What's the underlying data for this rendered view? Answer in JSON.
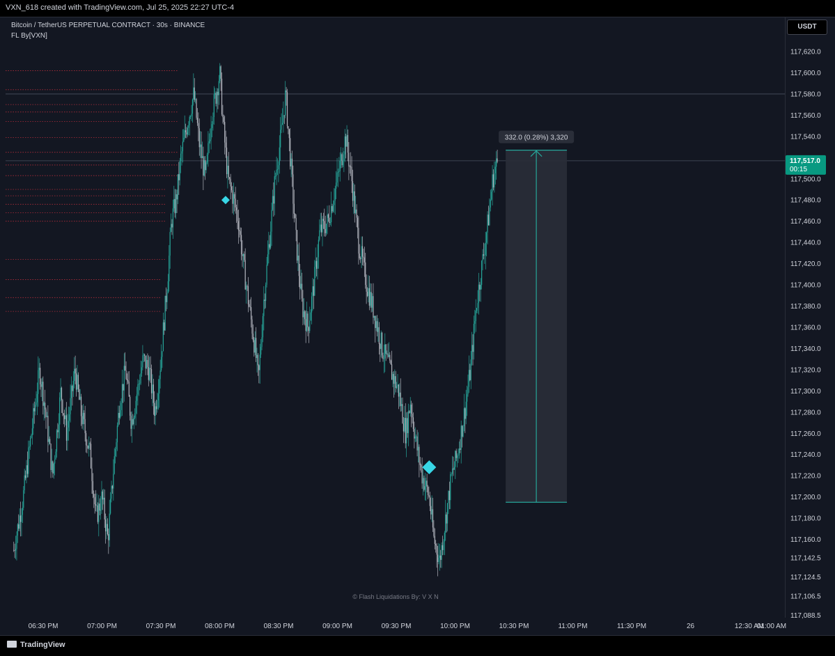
{
  "header": {
    "attribution": "VXN_618 created with TradingView.com, Jul 25, 2025 22:27 UTC-4"
  },
  "legend": {
    "symbol_line": "Bitcoin / TetherUS PERPETUAL CONTRACT · 30s · BINANCE",
    "indicator_line": "FL By[VXN]"
  },
  "currency_button": "USDT",
  "watermark": "© Flash Liquidations By: V X N",
  "footer": {
    "brand": "TradingView"
  },
  "colors": {
    "background": "#131722",
    "up": "#26a69a",
    "neutral": "#b2b5be",
    "marker": "#38d6e6",
    "price_tag": "#089981",
    "level": "#f23645"
  },
  "chart_data": {
    "type": "candlestick",
    "symbol": "BTCUSDT.P",
    "interval": "30s",
    "last_price": 117517.0,
    "last_price_label": "117,517.0",
    "countdown": "00:15",
    "ylim": [
      117080,
      117640
    ],
    "y_ticks": [
      117620,
      117600,
      117580,
      117560,
      117540,
      117520,
      117500,
      117480,
      117460,
      117440,
      117420,
      117400,
      117380,
      117360,
      117340,
      117320,
      117300,
      117280,
      117260,
      117240,
      117220,
      117200,
      117180,
      117160,
      117142.5,
      117124.5,
      117106.5,
      117088.5
    ],
    "y_tick_labels": [
      "117,620.0",
      "117,600.0",
      "117,580.0",
      "117,560.0",
      "117,540.0",
      "117,520.0",
      "117,500.0",
      "117,480.0",
      "117,460.0",
      "117,440.0",
      "117,420.0",
      "117,400.0",
      "117,380.0",
      "117,360.0",
      "117,340.0",
      "117,320.0",
      "117,300.0",
      "117,280.0",
      "117,260.0",
      "117,240.0",
      "117,220.0",
      "117,200.0",
      "117,180.0",
      "117,160.0",
      "117,142.5",
      "117,124.5",
      "117,106.5",
      "117,088.5"
    ],
    "x_tick_labels": [
      "06:30 PM",
      "07:00 PM",
      "07:30 PM",
      "08:00 PM",
      "08:30 PM",
      "09:00 PM",
      "09:30 PM",
      "10:00 PM",
      "10:30 PM",
      "11:00 PM",
      "11:30 PM",
      "26",
      "12:30 AM",
      "01:00 AM"
    ],
    "x_tick_hours": [
      18.5,
      19.0,
      19.5,
      20.0,
      20.5,
      21.0,
      21.5,
      22.0,
      22.5,
      23.0,
      23.5,
      24.0,
      24.5,
      25.0
    ],
    "price_path": [
      [
        18.25,
        117150
      ],
      [
        18.33,
        117200
      ],
      [
        18.4,
        117260
      ],
      [
        18.47,
        117320
      ],
      [
        18.52,
        117280
      ],
      [
        18.58,
        117220
      ],
      [
        18.65,
        117300
      ],
      [
        18.7,
        117260
      ],
      [
        18.77,
        117320
      ],
      [
        18.82,
        117280
      ],
      [
        18.9,
        117240
      ],
      [
        18.95,
        117180
      ],
      [
        19.0,
        117200
      ],
      [
        19.05,
        117160
      ],
      [
        19.1,
        117230
      ],
      [
        19.15,
        117290
      ],
      [
        19.2,
        117320
      ],
      [
        19.25,
        117270
      ],
      [
        19.3,
        117300
      ],
      [
        19.35,
        117330
      ],
      [
        19.4,
        117320
      ],
      [
        19.45,
        117280
      ],
      [
        19.5,
        117330
      ],
      [
        19.53,
        117370
      ],
      [
        19.56,
        117410
      ],
      [
        19.59,
        117460
      ],
      [
        19.63,
        117480
      ],
      [
        19.67,
        117520
      ],
      [
        19.72,
        117550
      ],
      [
        19.78,
        117580
      ],
      [
        19.83,
        117530
      ],
      [
        19.88,
        117500
      ],
      [
        19.93,
        117560
      ],
      [
        19.97,
        117580
      ],
      [
        20.0,
        117600
      ],
      [
        20.03,
        117550
      ],
      [
        20.07,
        117500
      ],
      [
        20.12,
        117480
      ],
      [
        20.16,
        117460
      ],
      [
        20.2,
        117420
      ],
      [
        20.25,
        117380
      ],
      [
        20.3,
        117340
      ],
      [
        20.33,
        117310
      ],
      [
        20.37,
        117380
      ],
      [
        20.42,
        117440
      ],
      [
        20.47,
        117500
      ],
      [
        20.52,
        117540
      ],
      [
        20.56,
        117580
      ],
      [
        20.6,
        117520
      ],
      [
        20.65,
        117440
      ],
      [
        20.7,
        117380
      ],
      [
        20.75,
        117360
      ],
      [
        20.8,
        117400
      ],
      [
        20.85,
        117450
      ],
      [
        20.92,
        117460
      ],
      [
        21.0,
        117500
      ],
      [
        21.07,
        117540
      ],
      [
        21.12,
        117500
      ],
      [
        21.18,
        117440
      ],
      [
        21.25,
        117400
      ],
      [
        21.32,
        117370
      ],
      [
        21.38,
        117340
      ],
      [
        21.45,
        117320
      ],
      [
        21.52,
        117300
      ],
      [
        21.58,
        117260
      ],
      [
        21.62,
        117290
      ],
      [
        21.67,
        117250
      ],
      [
        21.72,
        117220
      ],
      [
        21.78,
        117200
      ],
      [
        21.82,
        117160
      ],
      [
        21.87,
        117140
      ],
      [
        21.92,
        117180
      ],
      [
        21.97,
        117220
      ],
      [
        22.02,
        117240
      ],
      [
        22.08,
        117280
      ],
      [
        22.13,
        117320
      ],
      [
        22.18,
        117380
      ],
      [
        22.23,
        117420
      ],
      [
        22.28,
        117460
      ],
      [
        22.32,
        117500
      ],
      [
        22.36,
        117517
      ]
    ],
    "liquidation_levels": [
      117602,
      117584,
      117570,
      117563,
      117554,
      117539,
      117525,
      117513,
      117503,
      117490,
      117484,
      117476,
      117468,
      117460,
      117424,
      117405,
      117388,
      117375
    ],
    "markers": [
      {
        "hour": 20.05,
        "price": 117480,
        "size": "small"
      },
      {
        "hour": 21.78,
        "price": 117228,
        "size": "large"
      }
    ],
    "horizontal_lines": [
      117580,
      117517
    ],
    "measure": {
      "label": "332.0 (0.28%) 3,320",
      "change": 332.0,
      "percent": 0.28,
      "bars": 3320,
      "from_hour": 22.43,
      "to_hour": 22.95,
      "low": 117195,
      "high": 117527
    }
  }
}
